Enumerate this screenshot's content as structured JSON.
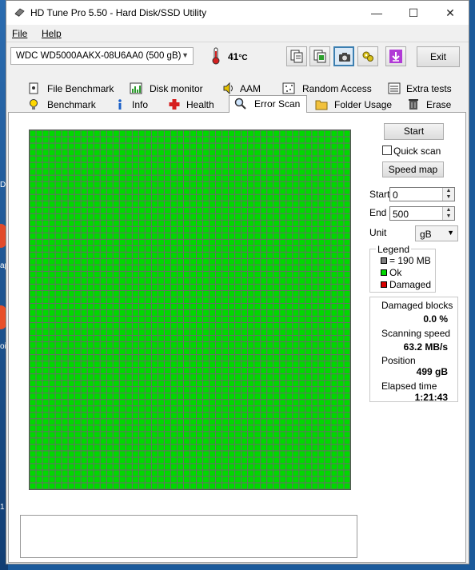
{
  "window": {
    "title": "HD Tune Pro 5.50 - Hard Disk/SSD Utility"
  },
  "window_controls": {
    "minimize": "—",
    "maximize": "☐",
    "close": "✕"
  },
  "menu": {
    "file": "File",
    "help": "Help"
  },
  "toolbar": {
    "drive": "WDC WD5000AAKX-08U6AA0 (500 gB)",
    "temperature": "41",
    "temperature_unit": "°C",
    "exit_label": "Exit",
    "icons": [
      "copy-info-icon",
      "copy-screen-icon",
      "screenshot-camera-icon",
      "settings-icon",
      "save-download-icon"
    ]
  },
  "tabs": {
    "row1": [
      "File Benchmark",
      "Disk monitor",
      "AAM",
      "Random Access",
      "Extra tests"
    ],
    "row2": [
      "Benchmark",
      "Info",
      "Health",
      "Error Scan",
      "Folder Usage",
      "Erase"
    ],
    "selected": "Error Scan"
  },
  "scan_grid": {
    "columns": 50,
    "rows": 56,
    "block_color_ok": "#00d800",
    "status": "all blocks ok"
  },
  "controls": {
    "start_button": "Start",
    "quick_scan_label": "Quick scan",
    "quick_scan_checked": false,
    "speed_map_button": "Speed map",
    "start_label": "Start",
    "start_value": "0",
    "end_label": "End",
    "end_value": "500",
    "unit_label": "Unit",
    "unit_value": "gB"
  },
  "legend": {
    "title": "Legend",
    "block_size": "= 190 MB",
    "ok": "Ok",
    "damaged": "Damaged",
    "colors": {
      "block": "#808080",
      "ok": "#00d800",
      "damaged": "#d80000"
    }
  },
  "stats": {
    "damaged_blocks_label": "Damaged blocks",
    "damaged_blocks_value": "0.0 %",
    "scanning_speed_label": "Scanning speed",
    "scanning_speed_value": "63.2 MB/s",
    "position_label": "Position",
    "position_value": "499 gB",
    "elapsed_label": "Elapsed time",
    "elapsed_value": "1:21:43"
  },
  "desktop": {
    "fragments": [
      "D",
      "ap",
      "oi",
      "1"
    ]
  }
}
